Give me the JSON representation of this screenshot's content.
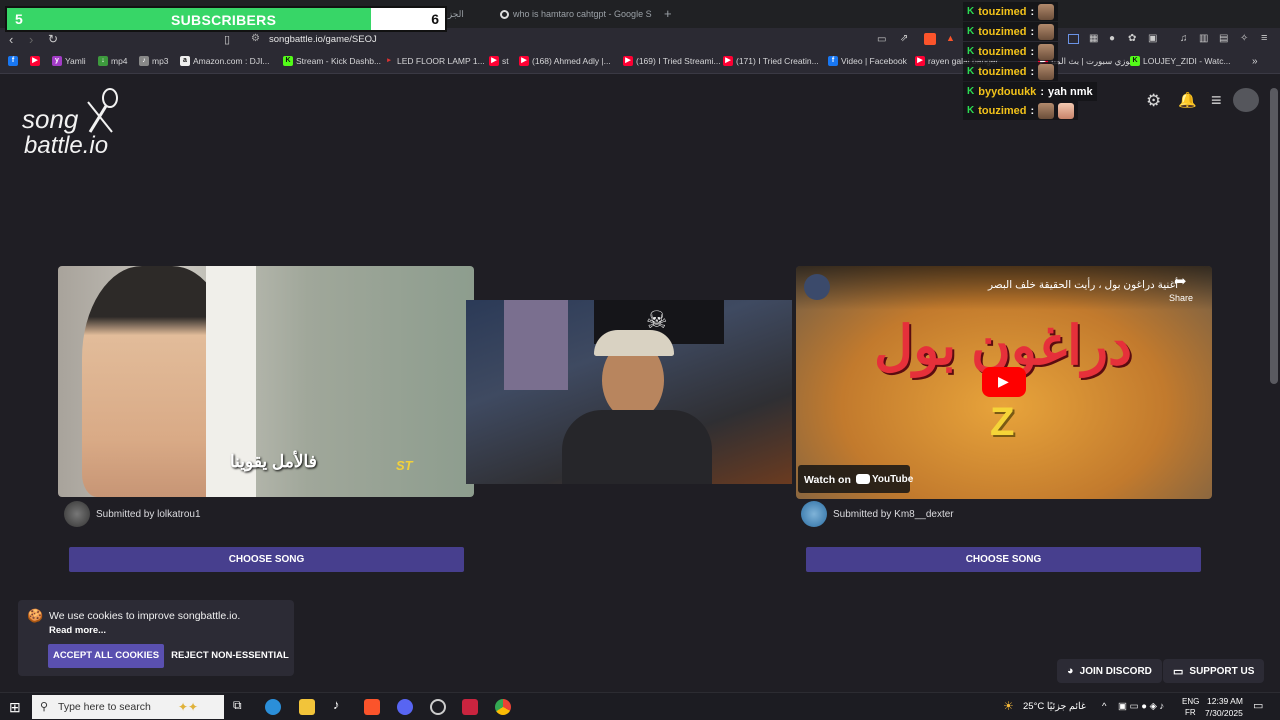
{
  "overlay": {
    "subs_count": "5",
    "subs_label": "SUBSCRIBERS",
    "subs_goal": "6",
    "subs_progress": 0.83,
    "chat": [
      {
        "user": "touzimed",
        "msg": ""
      },
      {
        "user": "touzimed",
        "msg": ""
      },
      {
        "user": "touzimed",
        "msg": ""
      },
      {
        "user": "touzimed",
        "msg": ""
      },
      {
        "user": "byydouukk",
        "msg": "yah nmk"
      },
      {
        "user": "touzimed",
        "msg": ""
      }
    ]
  },
  "browser": {
    "tabs": [
      {
        "label": "Spacetoon | الجزء الثاني"
      },
      {
        "label": "who is hamtaro cahtgpt - Google Se"
      }
    ],
    "url": "songbattle.io/game/SEOJ",
    "bookmarks": [
      {
        "label": "",
        "icon": "facebook-icon",
        "color": "#1877f2"
      },
      {
        "label": "",
        "icon": "youtube-icon",
        "color": "#ff0033"
      },
      {
        "label": "Yamli",
        "icon": "yamli-icon",
        "color": "#a33cc7"
      },
      {
        "label": "mp4",
        "icon": "download-icon",
        "color": "#3d9a3d"
      },
      {
        "label": "mp3",
        "icon": "mp3-icon",
        "color": "#a0a0a0"
      },
      {
        "label": "Amazon.com : DJI...",
        "icon": "amazon-icon",
        "color": "#333333"
      },
      {
        "label": "Stream - Kick Dashb...",
        "icon": "kick-icon",
        "color": "#53fc18"
      },
      {
        "label": "LED FLOOR LAMP 1...",
        "icon": "lamp-icon",
        "color": "#d33"
      },
      {
        "label": "st",
        "icon": "youtube-icon",
        "color": "#ff0033"
      },
      {
        "label": "(168) Ahmed Adly |...",
        "icon": "youtube-icon",
        "color": "#ff0033"
      },
      {
        "label": "(169) I Tried Streami...",
        "icon": "youtube-icon",
        "color": "#ff0033"
      },
      {
        "label": "(171) I Tried Creatin...",
        "icon": "youtube-icon",
        "color": "#ff0033"
      },
      {
        "label": "Video | Facebook",
        "icon": "facebook-icon",
        "color": "#1877f2"
      },
      {
        "label": "rayen galai banger",
        "icon": "youtube-icon",
        "color": "#ff0033"
      },
      {
        "label": "توزي سبورت | بث المبا",
        "icon": "youtube-icon",
        "color": "#ff0033"
      },
      {
        "label": "LOUJEY_ZIDI - Watc...",
        "icon": "kick-icon",
        "color": "#53fc18"
      }
    ]
  },
  "page": {
    "logo_line1": "song",
    "logo_line2": "battle.io",
    "left": {
      "submitted": "Submitted by lolkatrou1",
      "subtitle": "فالأمل يقوينا",
      "choose_label": "CHOOSE SONG"
    },
    "right": {
      "video_title": "أغنية دراغون بول ، رأيت الحقيقة خلف البصر",
      "share_label": "Share",
      "watch_on": "Watch on",
      "youtube_label": "YouTube",
      "submitted": "Submitted by Km8__dexter",
      "choose_label": "CHOOSE SONG"
    },
    "cookie": {
      "text": "We use cookies to improve songbattle.io.",
      "read_more": "Read more...",
      "accept": "ACCEPT ALL COOKIES",
      "reject": "REJECT NON-ESSENTIAL"
    },
    "join_discord": "JOIN DISCORD",
    "support_us": "SUPPORT US"
  },
  "taskbar": {
    "search_placeholder": "Type here to search",
    "weather": "25°C  غائم جزئيًا",
    "lang1": "ENG",
    "lang2": "FR",
    "time": "12:39 AM",
    "date": "7/30/2025"
  },
  "colors": {
    "accent": "#473f8e",
    "accept": "#5a50b0",
    "subs_green": "#37d667",
    "chat_user": "#f2c21a"
  }
}
